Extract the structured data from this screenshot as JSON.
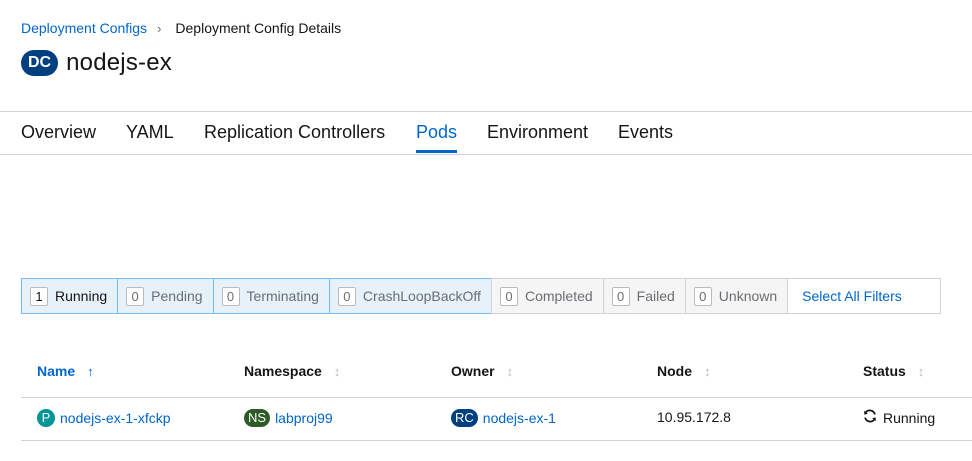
{
  "breadcrumb": {
    "parent": "Deployment Configs",
    "separator": "›",
    "current": "Deployment Config Details"
  },
  "title": {
    "badge": "DC",
    "name": "nodejs-ex"
  },
  "tabs": [
    {
      "label": "Overview",
      "active": false
    },
    {
      "label": "YAML",
      "active": false
    },
    {
      "label": "Replication Controllers",
      "active": false
    },
    {
      "label": "Pods",
      "active": true
    },
    {
      "label": "Environment",
      "active": false
    },
    {
      "label": "Events",
      "active": false
    }
  ],
  "filters": [
    {
      "count": "1",
      "label": "Running"
    },
    {
      "count": "0",
      "label": "Pending"
    },
    {
      "count": "0",
      "label": "Terminating"
    },
    {
      "count": "0",
      "label": "CrashLoopBackOff"
    },
    {
      "count": "0",
      "label": "Completed"
    },
    {
      "count": "0",
      "label": "Failed"
    },
    {
      "count": "0",
      "label": "Unknown"
    }
  ],
  "select_all_label": "Select All Filters",
  "table": {
    "columns": [
      "Name",
      "Namespace",
      "Owner",
      "Node",
      "Status"
    ],
    "sort_sorted_icon": "↑",
    "sort_unsorted_icon": "↕",
    "rows": [
      {
        "name_badge": "P",
        "name": "nodejs-ex-1-xfckp",
        "namespace_badge": "NS",
        "namespace": "labproj99",
        "owner_badge": "RC",
        "owner": "nodejs-ex-1",
        "node": "10.95.172.8",
        "status_icon": "sync-icon",
        "status": "Running"
      }
    ]
  },
  "colors": {
    "link": "#0066cc",
    "dc_badge": "#004080",
    "pod_badge": "#009596",
    "ns_badge": "#2d5c27",
    "rc_badge": "#004080",
    "filter_active_bg": "#e7f1fa"
  }
}
